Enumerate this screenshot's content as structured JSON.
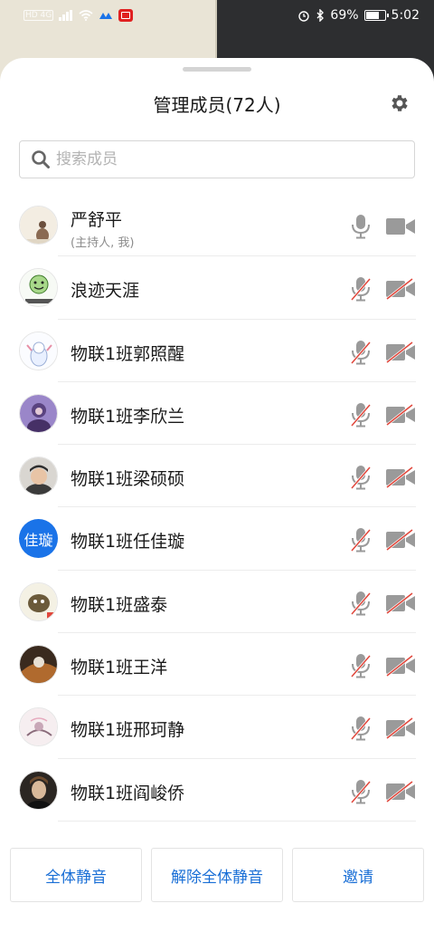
{
  "status_bar": {
    "network": "HD 4G",
    "battery": "69%",
    "time": "5:02"
  },
  "header": {
    "title": "管理成员(72人)"
  },
  "search": {
    "placeholder": "搜索成员"
  },
  "members": [
    {
      "name": "严舒平",
      "subtitle": "(主持人, 我)",
      "mic": "on",
      "camera": "on"
    },
    {
      "name": "浪迹天涯",
      "mic": "muted",
      "camera": "off"
    },
    {
      "name": "物联1班郭照醒",
      "mic": "muted",
      "camera": "off"
    },
    {
      "name": "物联1班李欣兰",
      "mic": "muted",
      "camera": "off"
    },
    {
      "name": "物联1班梁硕硕",
      "mic": "muted",
      "camera": "off"
    },
    {
      "name": "物联1班任佳璇",
      "avatar_text": "佳璇",
      "mic": "muted",
      "camera": "off"
    },
    {
      "name": "物联1班盛泰",
      "mic": "muted",
      "camera": "off"
    },
    {
      "name": "物联1班王洋",
      "mic": "muted",
      "camera": "off"
    },
    {
      "name": "物联1班邢珂静",
      "mic": "muted",
      "camera": "off"
    },
    {
      "name": "物联1班阎峻侨",
      "mic": "muted",
      "camera": "off"
    }
  ],
  "actions": {
    "mute_all": "全体静音",
    "unmute_all": "解除全体静音",
    "invite": "邀请"
  },
  "colors": {
    "accent": "#1a6fd6",
    "muted_slash": "#e0473c",
    "icon_gray": "#9a9a9a"
  }
}
